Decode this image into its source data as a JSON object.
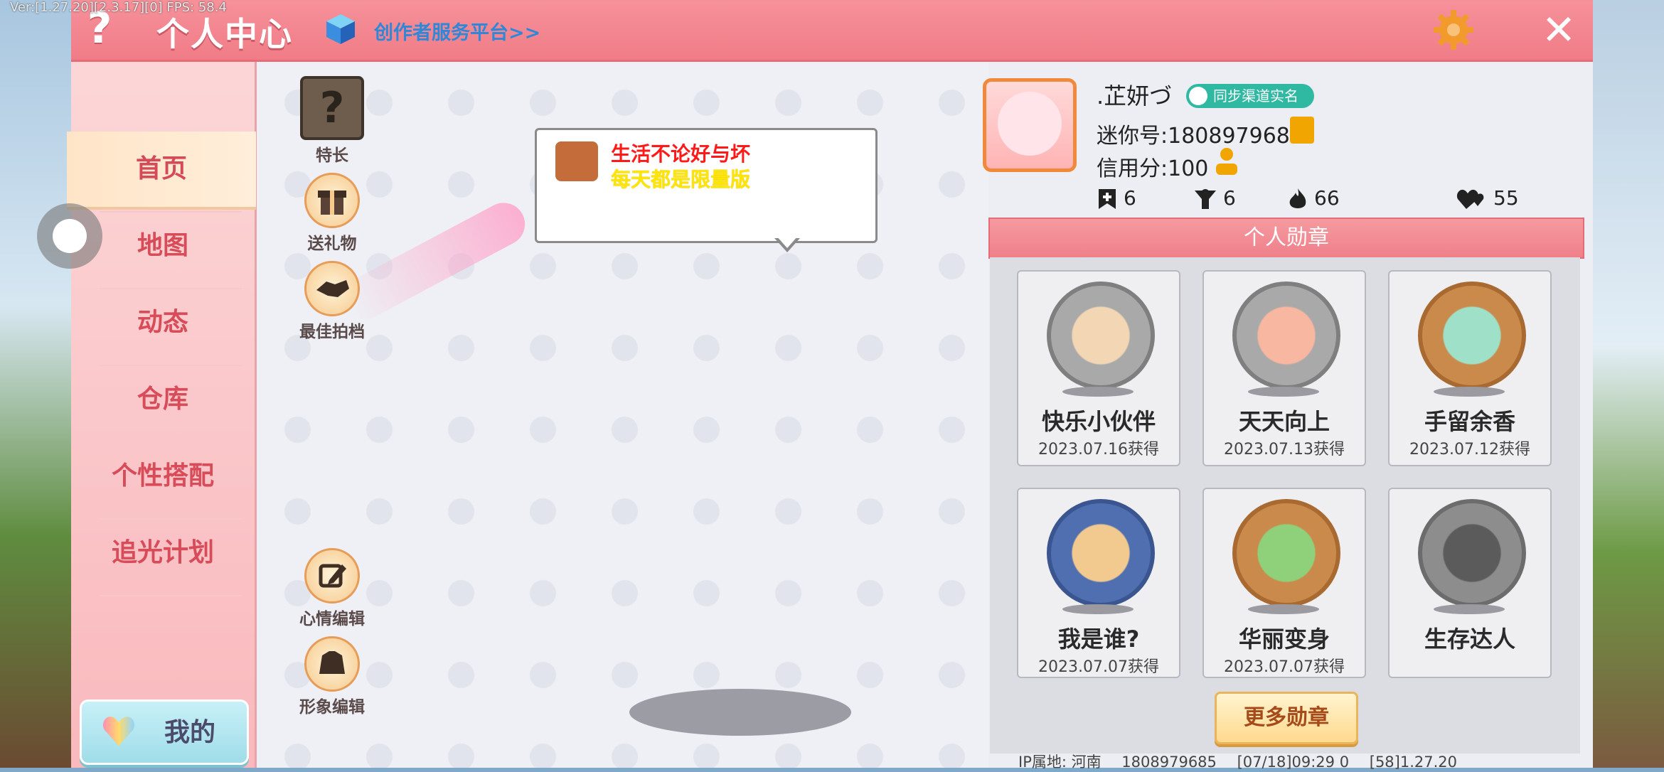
{
  "debug": {
    "version_text": "Ver:[1.27.20][2.3.17][0] FPS: 58.4"
  },
  "header": {
    "title": "个人中心",
    "creator_link": "创作者服务平台>>",
    "help_label": "?",
    "close_label": "✕"
  },
  "sidebar": {
    "items": [
      {
        "label": "首页",
        "active": true
      },
      {
        "label": "地图",
        "active": false
      },
      {
        "label": "动态",
        "active": false
      },
      {
        "label": "仓库",
        "active": false
      },
      {
        "label": "个性搭配",
        "active": false
      },
      {
        "label": "追光计划",
        "active": false
      }
    ],
    "mine_label": "我的"
  },
  "stage": {
    "tools_top": [
      {
        "label": "特长",
        "icon": "question-box-icon"
      },
      {
        "label": "送礼物",
        "icon": "gift-icon"
      },
      {
        "label": "最佳拍档",
        "icon": "handshake-icon"
      }
    ],
    "tools_bottom": [
      {
        "label": "心情编辑",
        "icon": "edit-icon"
      },
      {
        "label": "形象编辑",
        "icon": "outfit-icon"
      }
    ],
    "mood": {
      "line1": "生活不论好与坏",
      "line2": "每天都是限量版"
    }
  },
  "profile": {
    "nickname": ".芷妍づ",
    "realname_badge": "同步渠道实名",
    "mini_id": "迷你号:1808979685",
    "credit": "信用分:100",
    "stats": [
      {
        "icon": "bookmark-plus-icon",
        "value": "6"
      },
      {
        "icon": "person-cheer-icon",
        "value": "6"
      },
      {
        "icon": "flame-icon",
        "value": "66"
      },
      {
        "icon": "hearts-icon",
        "value": "55"
      }
    ]
  },
  "medals": {
    "header": "个人勋章",
    "items": [
      {
        "name": "快乐小伙伴",
        "date": "2023.07.16获得",
        "color": "#a9a9a9"
      },
      {
        "name": "天天向上",
        "date": "2023.07.13获得",
        "color": "#a9a9a9"
      },
      {
        "name": "手留余香",
        "date": "2023.07.12获得",
        "color": "#c98a4b"
      },
      {
        "name": "我是谁?",
        "date": "2023.07.07获得",
        "color": "#4f6fb0"
      },
      {
        "name": "华丽变身",
        "date": "2023.07.07获得",
        "color": "#c98a4b"
      },
      {
        "name": "生存达人",
        "date": "",
        "color": "#8d8d8d"
      }
    ],
    "more_label": "更多勋章"
  },
  "footer": {
    "ip_label": "IP属地: 河南",
    "id": "1808979685",
    "time": "[07/18]09:29 0",
    "version": "[58]1.27.20"
  },
  "colors": {
    "brand_pink": "#f07c87",
    "sidebar_text": "#d84c5a",
    "badge_teal": "#2fb8a2"
  }
}
